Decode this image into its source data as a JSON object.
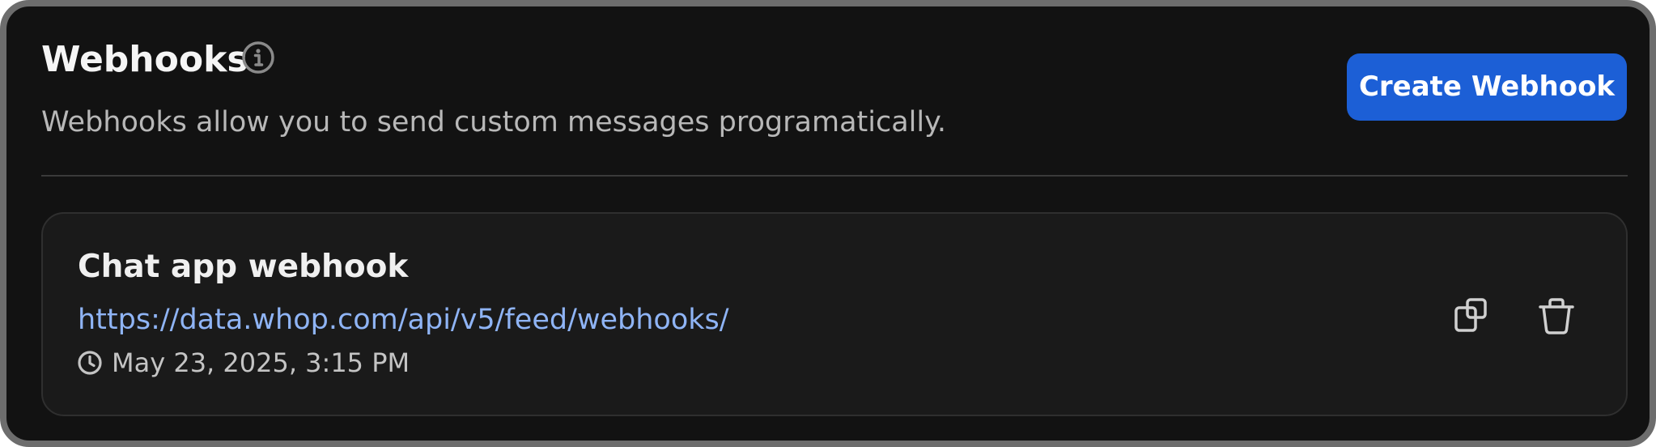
{
  "header": {
    "title": "Webhooks",
    "info_icon": "info-circle-icon",
    "subtitle": "Webhooks allow you to send custom messages programatically.",
    "create_button_label": "Create Webhook"
  },
  "webhooks": [
    {
      "name": "Chat app webhook",
      "url": "https://data.whop.com/api/v5/feed/webhooks/",
      "created_at": "May 23, 2025, 3:15 PM",
      "time_icon": "clock-icon",
      "actions": {
        "copy_icon": "copy-icon",
        "delete_icon": "trash-icon"
      }
    }
  ],
  "colors": {
    "background": "#121212",
    "frame": "#6d6d6d",
    "card_background": "#1a1a1a",
    "accent_button": "#1c5fd6",
    "link": "#8fb4f5",
    "text_primary": "#f5f5f5",
    "text_secondary": "#b8b8b8"
  }
}
